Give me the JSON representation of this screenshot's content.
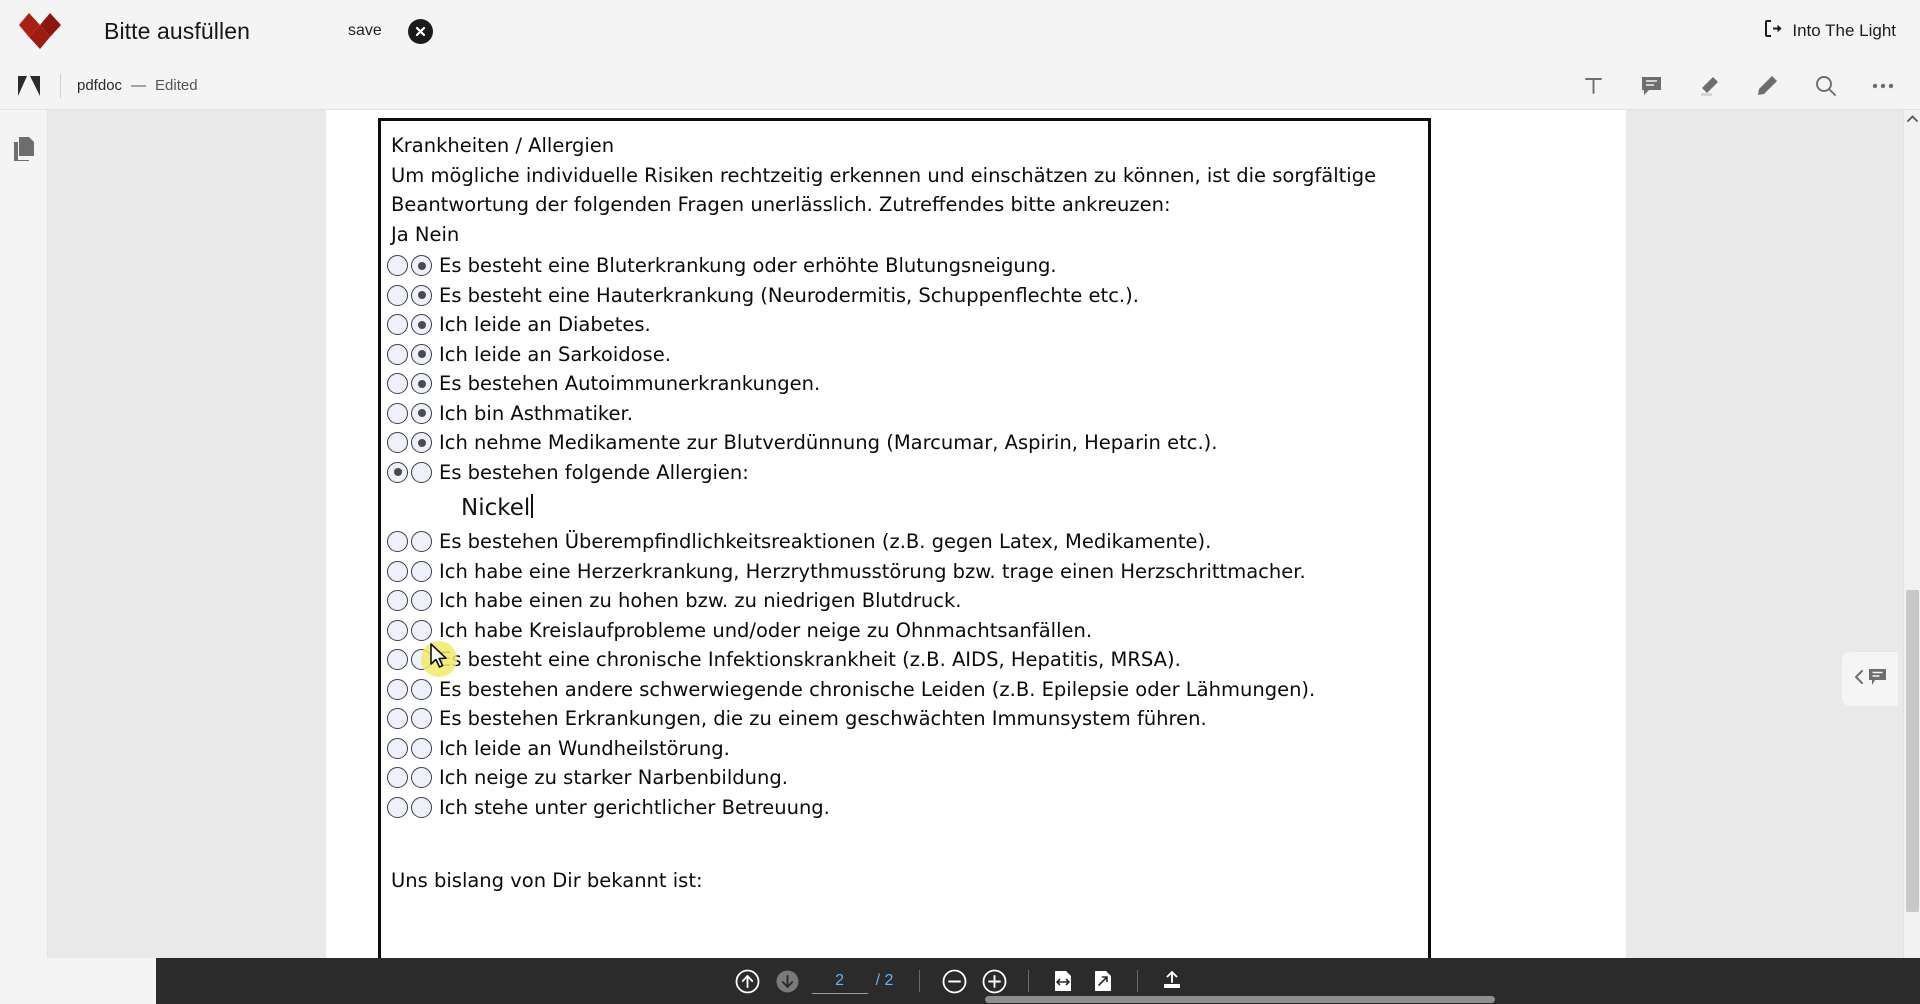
{
  "appbar": {
    "logo_icon": "red-diamond-logo",
    "title": "Bitte ausfüllen",
    "save_label": "save",
    "close_icon": "close-circle-icon",
    "right_action": {
      "icon": "exit-arrow-icon",
      "label": "Into The Light"
    }
  },
  "docbar": {
    "app_icon": "adobe-a-icon",
    "doc_name": "pdfdoc",
    "separator": "—",
    "status": "Edited",
    "tools": [
      {
        "name": "text-tool",
        "icon": "T"
      },
      {
        "name": "comment-tool",
        "icon": "comment-bubble-icon"
      },
      {
        "name": "highlight-tool",
        "icon": "highlighter-icon"
      },
      {
        "name": "draw-tool",
        "icon": "pen-icon"
      },
      {
        "name": "search-tool",
        "icon": "search-icon"
      },
      {
        "name": "more-tool",
        "icon": "ellipsis-icon"
      }
    ]
  },
  "leftrail": {
    "items": [
      {
        "name": "page-thumbnails",
        "icon": "pages-icon"
      }
    ]
  },
  "right_panel": {
    "toggle_icon_chevron": "chevron-left-icon",
    "toggle_icon_comment": "comment-bubble-icon"
  },
  "document": {
    "heading": "Krankheiten / Allergien",
    "intro": [
      "Um mögliche individuelle Risiken rechtzeitig erkennen und einschätzen zu können, ist die sorgfältige",
      "Beantwortung der folgenden Fragen unerlässlich. Zutreffendes bitte ankreuzen:"
    ],
    "column_headers": "Ja  Nein",
    "questions": [
      {
        "ja": false,
        "nein": true,
        "text": "Es besteht eine Bluterkrankung oder erhöhte Blutungsneigung."
      },
      {
        "ja": false,
        "nein": true,
        "text": "Es besteht eine Hauterkrankung (Neurodermitis, Schuppenflechte etc.)."
      },
      {
        "ja": false,
        "nein": true,
        "text": "Ich leide an Diabetes."
      },
      {
        "ja": false,
        "nein": true,
        "text": "Ich leide an Sarkoidose."
      },
      {
        "ja": false,
        "nein": true,
        "text": "Es bestehen Autoimmunerkrankungen."
      },
      {
        "ja": false,
        "nein": true,
        "text": "Ich bin Asthmatiker."
      },
      {
        "ja": false,
        "nein": true,
        "text": "Ich nehme Medikamente zur Blutverdünnung (Marcumar, Aspirin, Heparin etc.)."
      },
      {
        "ja": true,
        "nein": false,
        "text": "Es bestehen folgende Allergien:"
      }
    ],
    "allergy_value": "Nickel",
    "questions2": [
      {
        "ja": false,
        "nein": false,
        "text": "Es bestehen Überempfindlichkeitsreaktionen (z.B. gegen Latex, Medikamente)."
      },
      {
        "ja": false,
        "nein": false,
        "text": "Ich habe eine Herzerkrankung, Herzrythmusstörung bzw. trage einen Herzschrittmacher."
      },
      {
        "ja": false,
        "nein": false,
        "text": "Ich habe einen zu hohen bzw. zu niedrigen Blutdruck."
      },
      {
        "ja": false,
        "nein": false,
        "text": "Ich habe Kreislaufprobleme und/oder neige zu Ohnmachtsanfällen."
      },
      {
        "ja": false,
        "nein": false,
        "text": "Es besteht eine chronische Infektionskrankheit (z.B. AIDS, Hepatitis, MRSA)."
      },
      {
        "ja": false,
        "nein": false,
        "text": "Es bestehen andere schwerwiegende chronische Leiden (z.B. Epilepsie oder Lähmungen)."
      },
      {
        "ja": false,
        "nein": false,
        "text": "Es bestehen Erkrankungen, die zu einem geschwächten Immunsystem führen."
      },
      {
        "ja": false,
        "nein": false,
        "text": "Ich leide an Wundheilstörung."
      },
      {
        "ja": false,
        "nein": false,
        "text": "Ich neige zu starker Narbenbildung."
      },
      {
        "ja": false,
        "nein": false,
        "text": "Ich stehe unter gerichtlicher Betreuung."
      }
    ],
    "closing": "Uns bislang von Dir bekannt ist:"
  },
  "bottombar": {
    "prev_icon": "arrow-up-circle-icon",
    "next_icon": "arrow-down-circle-icon",
    "page_value": "2",
    "page_total": "/ 2",
    "zoom_out_icon": "minus-circle-icon",
    "zoom_in_icon": "plus-circle-icon",
    "fit_width_icon": "fit-width-icon",
    "fit_page_icon": "fit-page-icon",
    "share_icon": "upload-icon"
  },
  "colors": {
    "brand_red": "#a81f13",
    "appbar_bg": "#f4f4f4",
    "viewer_bg": "#e9e9e9",
    "bottombar_bg": "#2b2b2b",
    "page_number_accent": "#69b2f0",
    "cursor_highlight": "#f2ea6a"
  }
}
